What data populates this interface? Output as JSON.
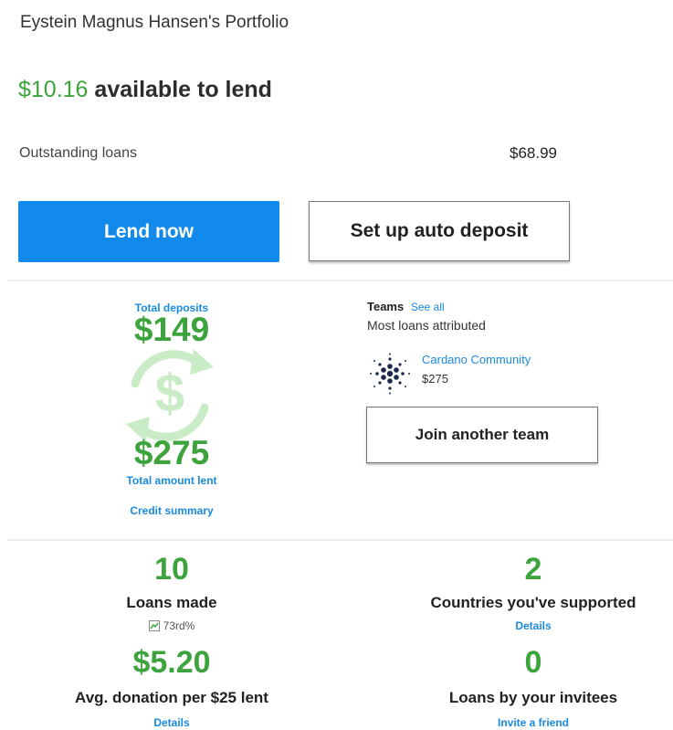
{
  "header": {
    "portfolio_title": "Eystein Magnus Hansen's Portfolio",
    "available_amount": "$10.16",
    "available_suffix": " available to lend"
  },
  "outstanding": {
    "label": "Outstanding loans",
    "value": "$68.99"
  },
  "actions": {
    "lend_now": "Lend now",
    "auto_deposit": "Set up auto deposit"
  },
  "credit": {
    "total_deposits_label": "Total deposits",
    "total_deposits_value": "$149",
    "total_lent_value": "$275",
    "total_lent_label": "Total amount lent",
    "credit_summary_link": "Credit summary",
    "icon": "dollar-cycle-icon"
  },
  "teams": {
    "heading": "Teams",
    "see_all": "See all",
    "subheading": "Most loans attributed",
    "team_name": "Cardano Community",
    "team_amount": "$275",
    "team_icon": "cardano-logo-icon",
    "join_button": "Join another team"
  },
  "stats": {
    "loans_made_value": "10",
    "loans_made_label": "Loans made",
    "loans_made_rank": "73rd%",
    "countries_value": "2",
    "countries_label": "Countries you've supported",
    "countries_link": "Details",
    "avg_donation_value": "$5.20",
    "avg_donation_label": "Avg. donation per $25 lent",
    "avg_donation_link": "Details",
    "invitee_loans_value": "0",
    "invitee_loans_label": "Loans by your invitees",
    "invite_link": "Invite a friend"
  },
  "colors": {
    "green": "#3da33d",
    "blue": "#118aec",
    "link_blue": "#1a8ae0"
  }
}
